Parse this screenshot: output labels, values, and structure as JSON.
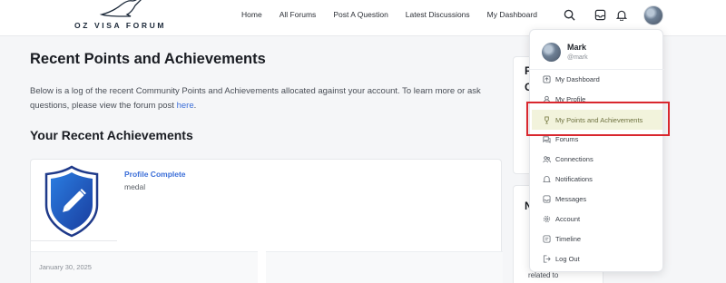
{
  "header": {
    "logo_text": "OZ VISA FORUM",
    "nav": [
      "Home",
      "All Forums",
      "Post A Question",
      "Latest Discussions",
      "My Dashboard"
    ],
    "icons": [
      "search-icon",
      "inbox-icon",
      "bell-icon"
    ]
  },
  "main": {
    "page_title": "Recent Points and Achievements",
    "intro_text": "Below is a log of the recent Community Points and Achievements allocated against your account. To learn more or ask questions, please view the forum post ",
    "intro_link": "here",
    "intro_end": ".",
    "section_title": "Your Recent Achievements",
    "achievement": {
      "title": "Profile Complete",
      "type": "medal",
      "date": "January 30, 2025"
    }
  },
  "sidebar": {
    "card1_letters": [
      "P",
      "C"
    ],
    "card2_letter": "N",
    "card2_text": "related to"
  },
  "dropdown": {
    "name": "Mark",
    "handle": "@mark",
    "items": [
      {
        "label": "My Dashboard",
        "icon": "dashboard-icon"
      },
      {
        "label": "My Profile",
        "icon": "user-icon"
      },
      {
        "label": "My Points and Achievements",
        "icon": "trophy-icon"
      },
      {
        "label": "Forums",
        "icon": "forum-icon"
      },
      {
        "label": "Connections",
        "icon": "connections-icon"
      },
      {
        "label": "Notifications",
        "icon": "bell-icon"
      },
      {
        "label": "Messages",
        "icon": "inbox-icon"
      },
      {
        "label": "Account",
        "icon": "gear-icon"
      },
      {
        "label": "Timeline",
        "icon": "timeline-icon"
      },
      {
        "label": "Log Out",
        "icon": "logout-icon"
      }
    ],
    "active_index": 2
  },
  "colors": {
    "accent": "#3b6ed8",
    "highlight": "#d9272e",
    "active_bg": "#f2f3dc"
  }
}
